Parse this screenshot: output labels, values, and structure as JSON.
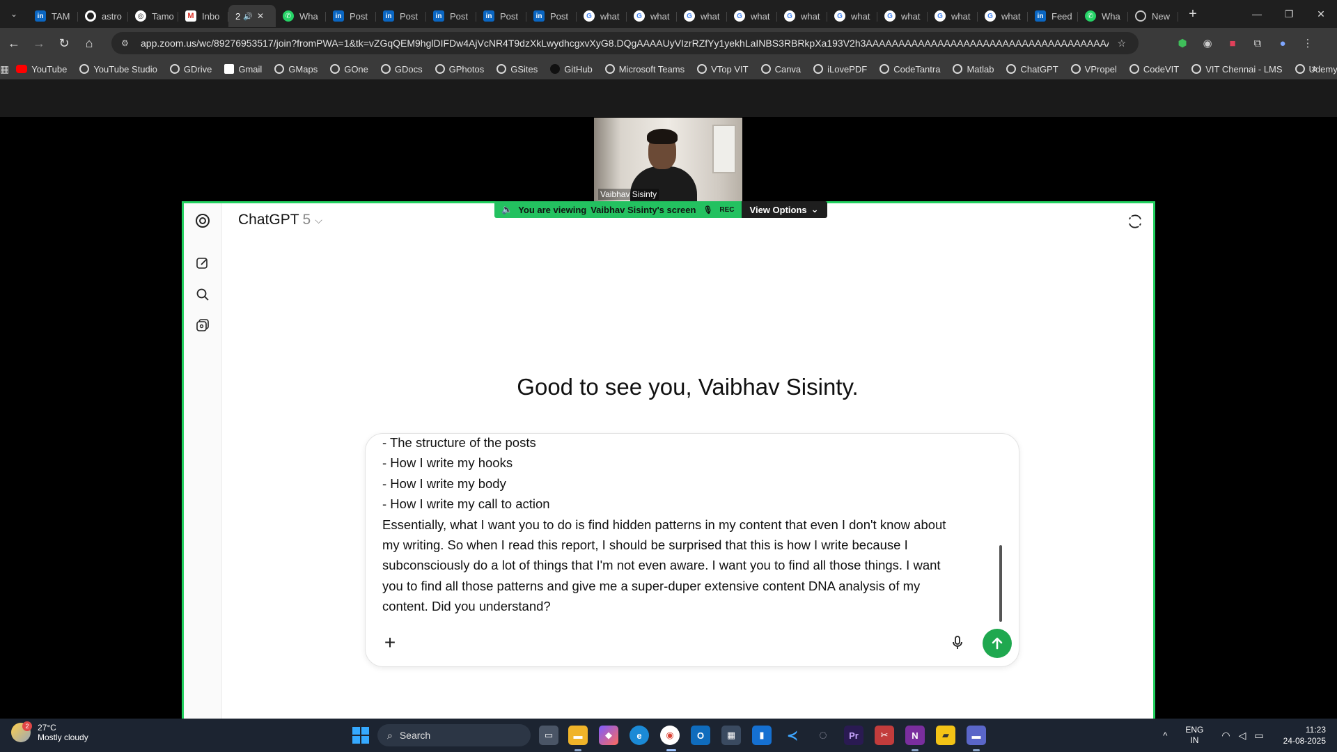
{
  "browser": {
    "tabs": [
      {
        "label": "TAM",
        "icon": "linkedin-icon"
      },
      {
        "label": "astro",
        "icon": "github-icon"
      },
      {
        "label": "Tamo",
        "icon": "generic-site-icon"
      },
      {
        "label": "Inbo",
        "icon": "gmail-icon"
      },
      {
        "label": "2",
        "icon": "zoom-icon",
        "active": true
      },
      {
        "label": "Wha",
        "icon": "whatsapp-icon"
      },
      {
        "label": "Post",
        "icon": "linkedin-icon"
      },
      {
        "label": "Post",
        "icon": "linkedin-icon"
      },
      {
        "label": "Post",
        "icon": "linkedin-icon"
      },
      {
        "label": "Post",
        "icon": "linkedin-icon"
      },
      {
        "label": "Post",
        "icon": "linkedin-icon"
      },
      {
        "label": "what",
        "icon": "google-icon"
      },
      {
        "label": "what",
        "icon": "google-icon"
      },
      {
        "label": "what",
        "icon": "google-icon"
      },
      {
        "label": "what",
        "icon": "google-icon"
      },
      {
        "label": "what",
        "icon": "google-icon"
      },
      {
        "label": "what",
        "icon": "google-icon"
      },
      {
        "label": "what",
        "icon": "google-icon"
      },
      {
        "label": "what",
        "icon": "google-icon"
      },
      {
        "label": "what",
        "icon": "google-icon"
      },
      {
        "label": "Feed",
        "icon": "linkedin-icon"
      },
      {
        "label": "Wha",
        "icon": "whatsapp-icon"
      },
      {
        "label": "New",
        "icon": "new-tab-icon"
      }
    ],
    "url": "app.zoom.us/wc/89276953517/join?fromPWA=1&tk=vZGqQEM9hglDIFDw4AjVcNR4T9dzXkLwydhcgxvXyG8.DQgAAAAUyVIzrRZfYy1yekhLaINBS3RBRkpXa193V2h3AAAAAAAAAAAAAAAAAAAAAAAAAAAAAAAAAAAAAAAAAA&_x_zm_r...",
    "bookmarks": [
      "YouTube",
      "YouTube Studio",
      "GDrive",
      "Gmail",
      "GMaps",
      "GOne",
      "GDocs",
      "GPhotos",
      "GSites",
      "GitHub",
      "Microsoft Teams",
      "VTop VIT",
      "Canva",
      "iLovePDF",
      "CodeTantra",
      "Matlab",
      "ChatGPT",
      "VPropel",
      "CodeVIT",
      "VIT Chennai - LMS",
      "Udemy"
    ]
  },
  "zoom": {
    "participant_name": "Vaibhav Sisinty",
    "banner": {
      "viewing_text": "You are viewing",
      "screen_owner": "Vaibhav Sisinty's screen",
      "rec": "REC",
      "view_options": "View Options"
    }
  },
  "chatgpt": {
    "model_name": "ChatGPT",
    "model_version": "5",
    "greeting": "Good to see you, Vaibhav Sisinty.",
    "composer_lines": [
      "- The structure of the posts",
      "- How I write my hooks",
      "- How I write my body",
      "- How I write my call to action",
      "Essentially, what I want you to do is find hidden patterns in my content that even I don't know about",
      "my writing. So when I read this report, I should be surprised that this is how I write because I",
      "subconsciously do a lot of things that I'm not even aware. I want you to find all those things. I want",
      "you to find all those patterns and give me a super-duper extensive content DNA analysis of my",
      "content. Did you understand?"
    ]
  },
  "taskbar": {
    "weather_temp": "27°C",
    "weather_desc": "Mostly cloudy",
    "weather_badge": "2",
    "search_label": "Search",
    "lang_top": "ENG",
    "lang_bottom": "IN",
    "time": "11:23",
    "date": "24-08-2025"
  },
  "colors": {
    "share_border": "#23d160",
    "send_button": "#1fa84f",
    "taskbar": "#1c2431"
  }
}
